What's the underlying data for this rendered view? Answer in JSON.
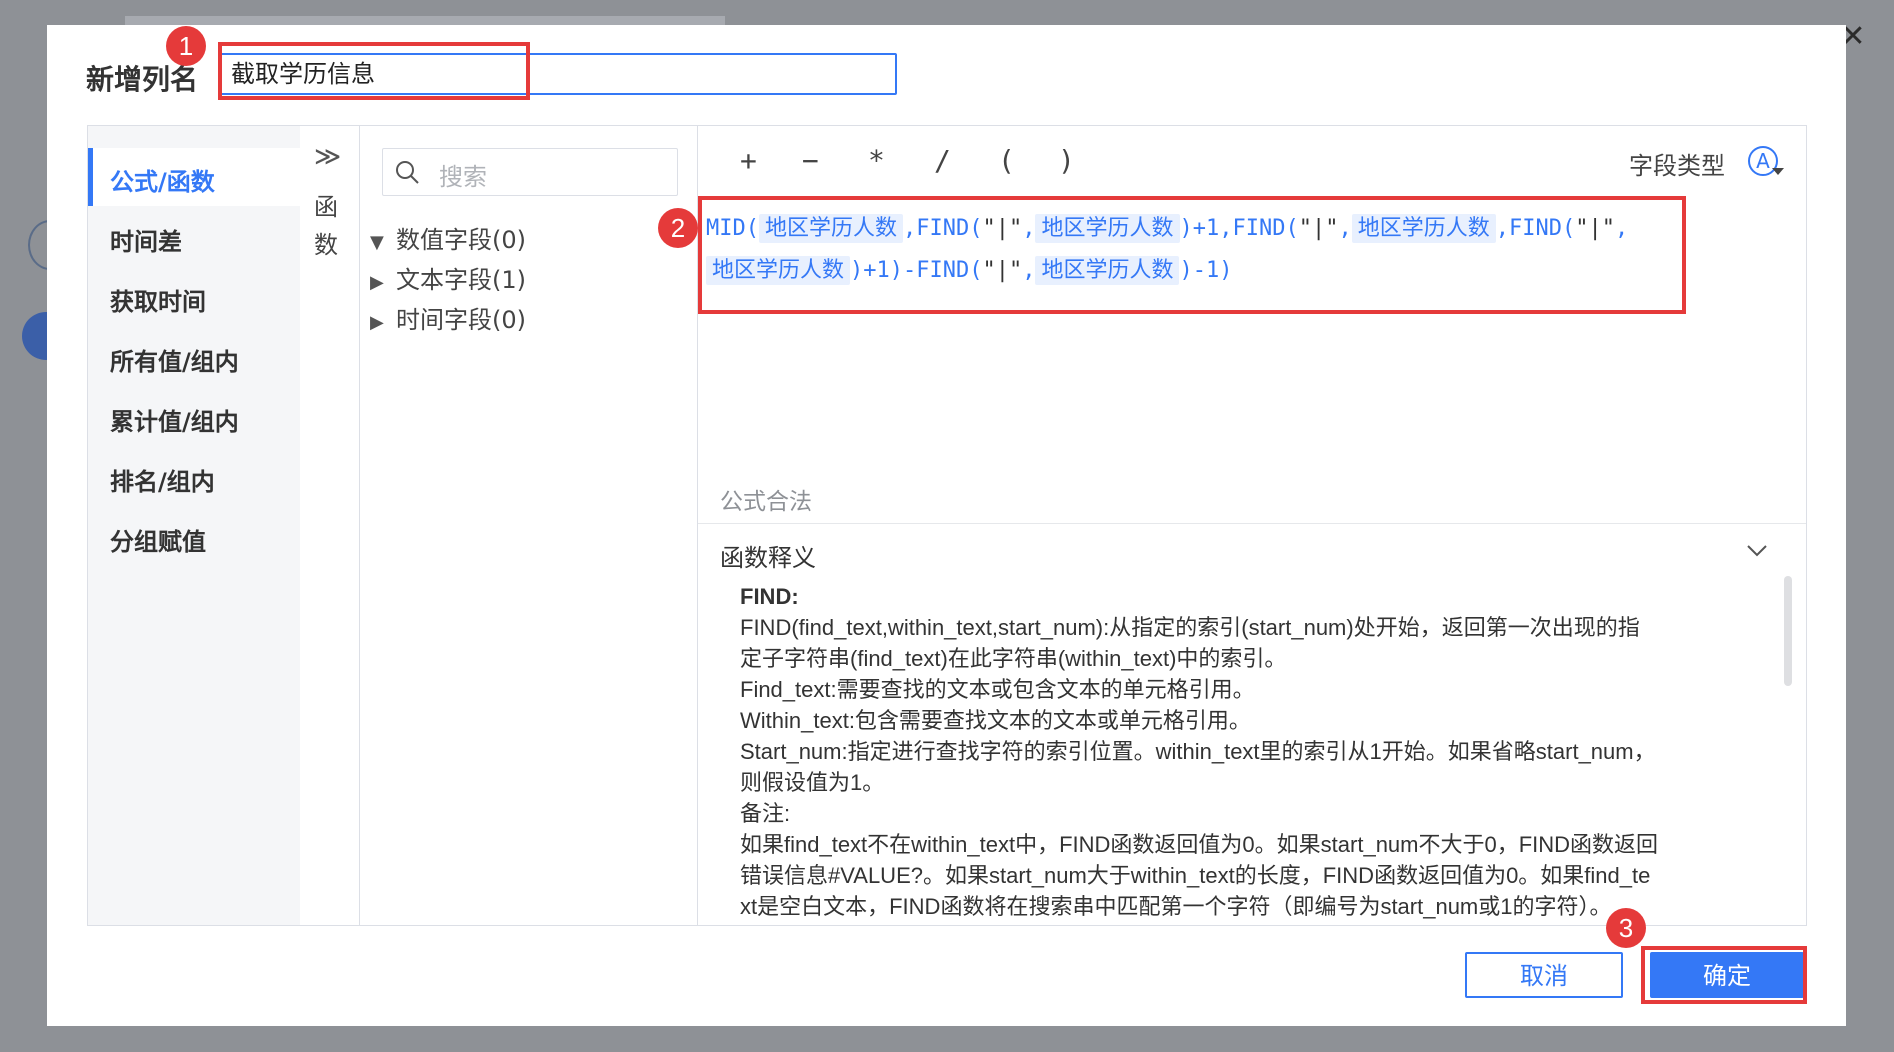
{
  "dialog": {
    "title": "新增列名",
    "column_name_value": "截取学历信息",
    "close_icon": "close-icon"
  },
  "callouts": [
    "1",
    "2",
    "3"
  ],
  "sidebar": {
    "items": [
      {
        "label": "公式/函数",
        "active": true
      },
      {
        "label": "时间差"
      },
      {
        "label": "获取时间"
      },
      {
        "label": "所有值/组内"
      },
      {
        "label": "累计值/组内"
      },
      {
        "label": "排名/组内"
      },
      {
        "label": "分组赋值"
      }
    ]
  },
  "functions_tab": {
    "expand_icon": "double-chevron-right-icon",
    "label": "函数"
  },
  "fields": {
    "search_placeholder": "搜索",
    "groups": [
      {
        "label": "数值字段(0)",
        "expanded": true
      },
      {
        "label": "文本字段(1)",
        "expanded": false
      },
      {
        "label": "时间字段(0)",
        "expanded": false
      }
    ]
  },
  "editor": {
    "operators": [
      "+",
      "−",
      "*",
      "/",
      "(",
      ")"
    ],
    "field_type_label": "字段类型",
    "field_type_icon": "text-type-icon",
    "formula_line1": [
      {
        "t": "fn",
        "v": "MID("
      },
      {
        "t": "chip",
        "v": "地区学历人数"
      },
      {
        "t": "fn",
        "v": ",FIND("
      },
      {
        "t": "txt",
        "v": "\"|\""
      },
      {
        "t": "fn",
        "v": ","
      },
      {
        "t": "chip",
        "v": "地区学历人数"
      },
      {
        "t": "fn",
        "v": ")+1,FIND("
      },
      {
        "t": "txt",
        "v": "\"|\""
      },
      {
        "t": "fn",
        "v": ","
      },
      {
        "t": "chip",
        "v": "地区学历人数"
      },
      {
        "t": "fn",
        "v": ",FIND("
      },
      {
        "t": "txt",
        "v": "\"|\""
      },
      {
        "t": "fn",
        "v": ","
      }
    ],
    "formula_line2": [
      {
        "t": "chip",
        "v": "地区学历人数"
      },
      {
        "t": "fn",
        "v": ")+1)-FIND("
      },
      {
        "t": "txt",
        "v": "\"|\""
      },
      {
        "t": "fn",
        "v": ","
      },
      {
        "t": "chip",
        "v": "地区学历人数"
      },
      {
        "t": "fn",
        "v": ")-1)"
      }
    ],
    "status": "公式合法"
  },
  "explanation": {
    "header": "函数释义",
    "title": "FIND:",
    "lines": [
      "FIND(find_text,within_text,start_num):从指定的索引(start_num)处开始，返回第一次出现的指",
      "定子字符串(find_text)在此字符串(within_text)中的索引。",
      "Find_text:需要查找的文本或包含文本的单元格引用。",
      "Within_text:包含需要查找文本的文本或单元格引用。",
      "Start_num:指定进行查找字符的索引位置。within_text里的索引从1开始。如果省略start_num，",
      "则假设值为1。",
      "备注:",
      "如果find_text不在within_text中，FIND函数返回值为0。如果start_num不大于0，FIND函数返回",
      "错误信息#VALUE?。如果start_num大于within_text的长度，FIND函数返回值为0。如果find_te",
      "xt是空白文本，FIND函数将在搜索串中匹配第一个字符（即编号为start_num或1的字符）。"
    ]
  },
  "buttons": {
    "cancel": "取消",
    "ok": "确定"
  },
  "colors": {
    "accent": "#3478f6",
    "callout": "#e53a3a"
  }
}
